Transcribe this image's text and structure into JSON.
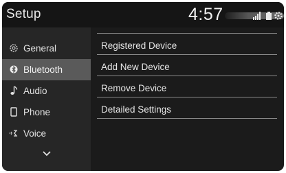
{
  "header": {
    "title": "Setup",
    "time": "4:57"
  },
  "status_icons": [
    "signal-icon",
    "battery-icon",
    "settings-icon"
  ],
  "sidebar": {
    "items": [
      {
        "label": "General",
        "icon": "gear-icon",
        "selected": false
      },
      {
        "label": "Bluetooth",
        "icon": "bluetooth-icon",
        "selected": true
      },
      {
        "label": "Audio",
        "icon": "music-note-icon",
        "selected": false
      },
      {
        "label": "Phone",
        "icon": "phone-icon",
        "selected": false
      },
      {
        "label": "Voice",
        "icon": "voice-icon",
        "selected": false
      }
    ],
    "more_icon": "chevron-down-icon"
  },
  "menu": {
    "items": [
      {
        "label": "Registered Device"
      },
      {
        "label": "Add New Device"
      },
      {
        "label": "Remove Device"
      },
      {
        "label": "Detailed Settings"
      }
    ]
  },
  "colors": {
    "background": "#1b1b1b",
    "sidebar": "#262626",
    "selected": "#5a5a5a",
    "text": "#e6e6e6"
  }
}
